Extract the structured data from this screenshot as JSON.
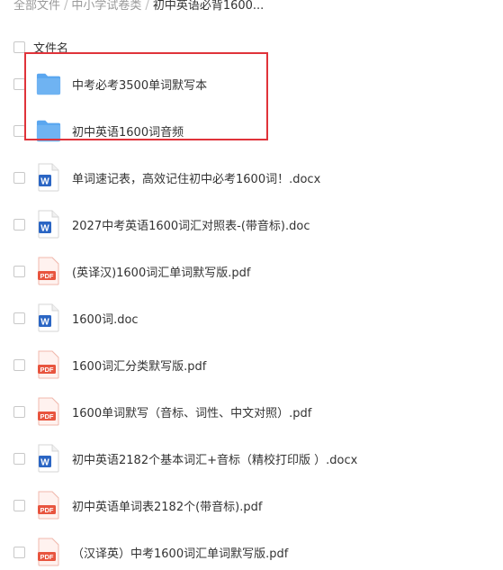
{
  "breadcrumb": {
    "items": [
      "全部文件",
      "中小学试卷类"
    ],
    "current": "初中英语必背1600..."
  },
  "list_header": {
    "name_label": "文件名"
  },
  "files": [
    {
      "name": "中考必考3500单词默写本",
      "type": "folder"
    },
    {
      "name": "初中英语1600词音频",
      "type": "folder"
    },
    {
      "name": "单词速记表，高效记住初中必考1600词！.docx",
      "type": "word"
    },
    {
      "name": "2027中考英语1600词汇对照表-(带音标).doc",
      "type": "word"
    },
    {
      "name": "(英译汉)1600词汇单词默写版.pdf",
      "type": "pdf"
    },
    {
      "name": "1600词.doc",
      "type": "word"
    },
    {
      "name": "1600词汇分类默写版.pdf",
      "type": "pdf"
    },
    {
      "name": "1600单词默写（音标、词性、中文对照）.pdf",
      "type": "pdf"
    },
    {
      "name": "初中英语2182个基本词汇+音标（精校打印版 ）.docx",
      "type": "word"
    },
    {
      "name": "初中英语单词表2182个(带音标).pdf",
      "type": "pdf"
    },
    {
      "name": "（汉译英）中考1600词汇单词默写版.pdf",
      "type": "pdf"
    }
  ],
  "icons": {
    "folder": "folder-icon",
    "word": "word-doc-icon",
    "pdf": "pdf-doc-icon"
  },
  "colors": {
    "highlight": "#e0333a",
    "folder": "#6fb3f2",
    "word": "#2b66c4",
    "pdf": "#e8553f"
  },
  "pdf_badge": "PDF",
  "word_badge": "W"
}
